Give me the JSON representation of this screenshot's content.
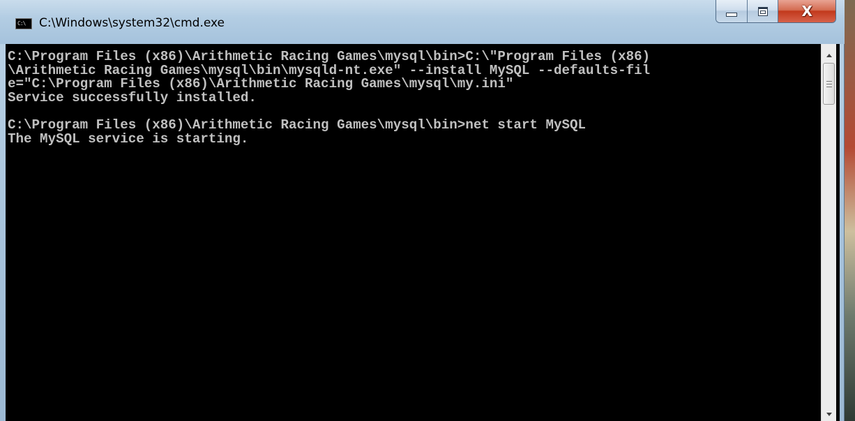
{
  "window": {
    "title": "C:\\Windows\\system32\\cmd.exe",
    "icon_text": "C:\\"
  },
  "caption_buttons": {
    "minimize": "minimize-icon",
    "maximize": "maximize-icon",
    "close_glyph": "X"
  },
  "console": {
    "lines": [
      "C:\\Program Files (x86)\\Arithmetic Racing Games\\mysql\\bin>C:\\\"Program Files (x86)",
      "\\Arithmetic Racing Games\\mysql\\bin\\mysqld-nt.exe\" --install MySQL --defaults-fil",
      "e=\"C:\\Program Files (x86)\\Arithmetic Racing Games\\mysql\\my.ini\"",
      "Service successfully installed.",
      "",
      "C:\\Program Files (x86)\\Arithmetic Racing Games\\mysql\\bin>net start MySQL",
      "The MySQL service is starting."
    ]
  },
  "colors": {
    "console_background": "#000000",
    "console_text": "#c0c0c0",
    "close_button": "#c2391c"
  }
}
